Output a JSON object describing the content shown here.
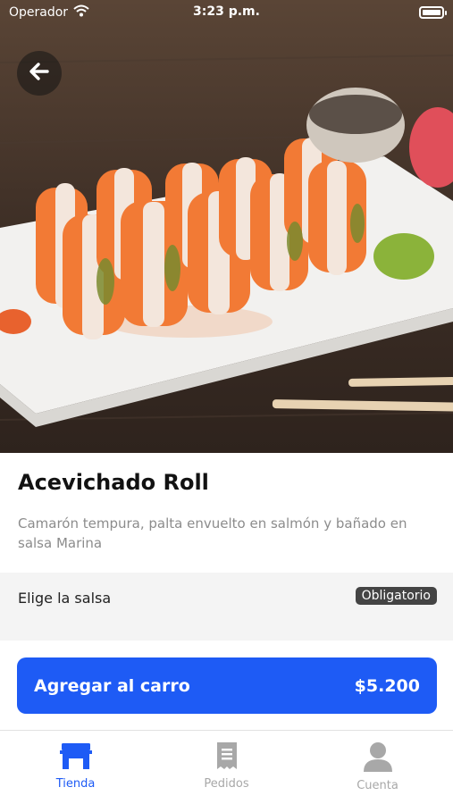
{
  "status_bar": {
    "carrier": "Operador",
    "time": "3:23 p.m."
  },
  "product": {
    "image_alt": "Acevichado Roll",
    "title": "Acevichado Roll",
    "description": "Camarón tempura, palta envuelto en salmón y bañado en salsa  Marina"
  },
  "options": {
    "section_label": "Elige la salsa",
    "required_badge": "Obligatorio"
  },
  "cart_button": {
    "label": "Agregar al carro",
    "price": "$5.200"
  },
  "tab_bar": {
    "tabs": [
      {
        "label": "Tienda",
        "icon": "store-icon",
        "active": true
      },
      {
        "label": "Pedidos",
        "icon": "receipt-icon",
        "active": false
      },
      {
        "label": "Cuenta",
        "icon": "user-icon",
        "active": false
      }
    ]
  },
  "colors": {
    "accent": "#1e5bf5",
    "badge": "#444444",
    "section_bg": "#f4f4f4"
  }
}
